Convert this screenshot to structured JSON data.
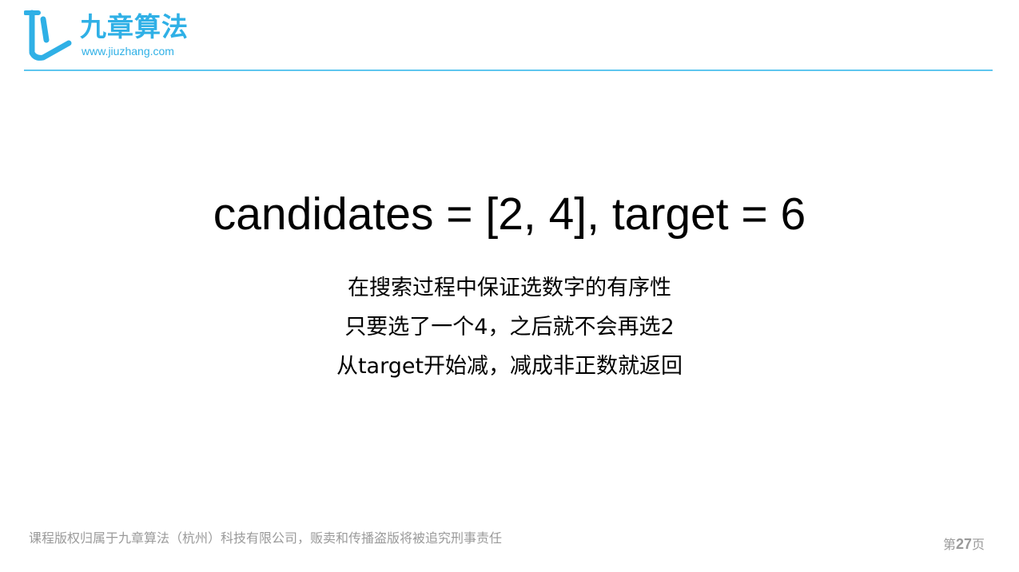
{
  "header": {
    "brand_name": "九章算法",
    "brand_url": "www.jiuzhang.com",
    "accent_color": "#2fb0e6"
  },
  "slide": {
    "title": "candidates = [2, 4], target = 6",
    "notes": [
      "在搜索过程中保证选数字的有序性",
      "只要选了一个4，之后就不会再选2",
      "从target开始减，减成非正数就返回"
    ]
  },
  "footer": {
    "copyright": "课程版权归属于九章算法（杭州）科技有限公司，贩卖和传播盗版将被追究刑事责任",
    "page_prefix": "第",
    "page_number": "27",
    "page_suffix": "页"
  }
}
